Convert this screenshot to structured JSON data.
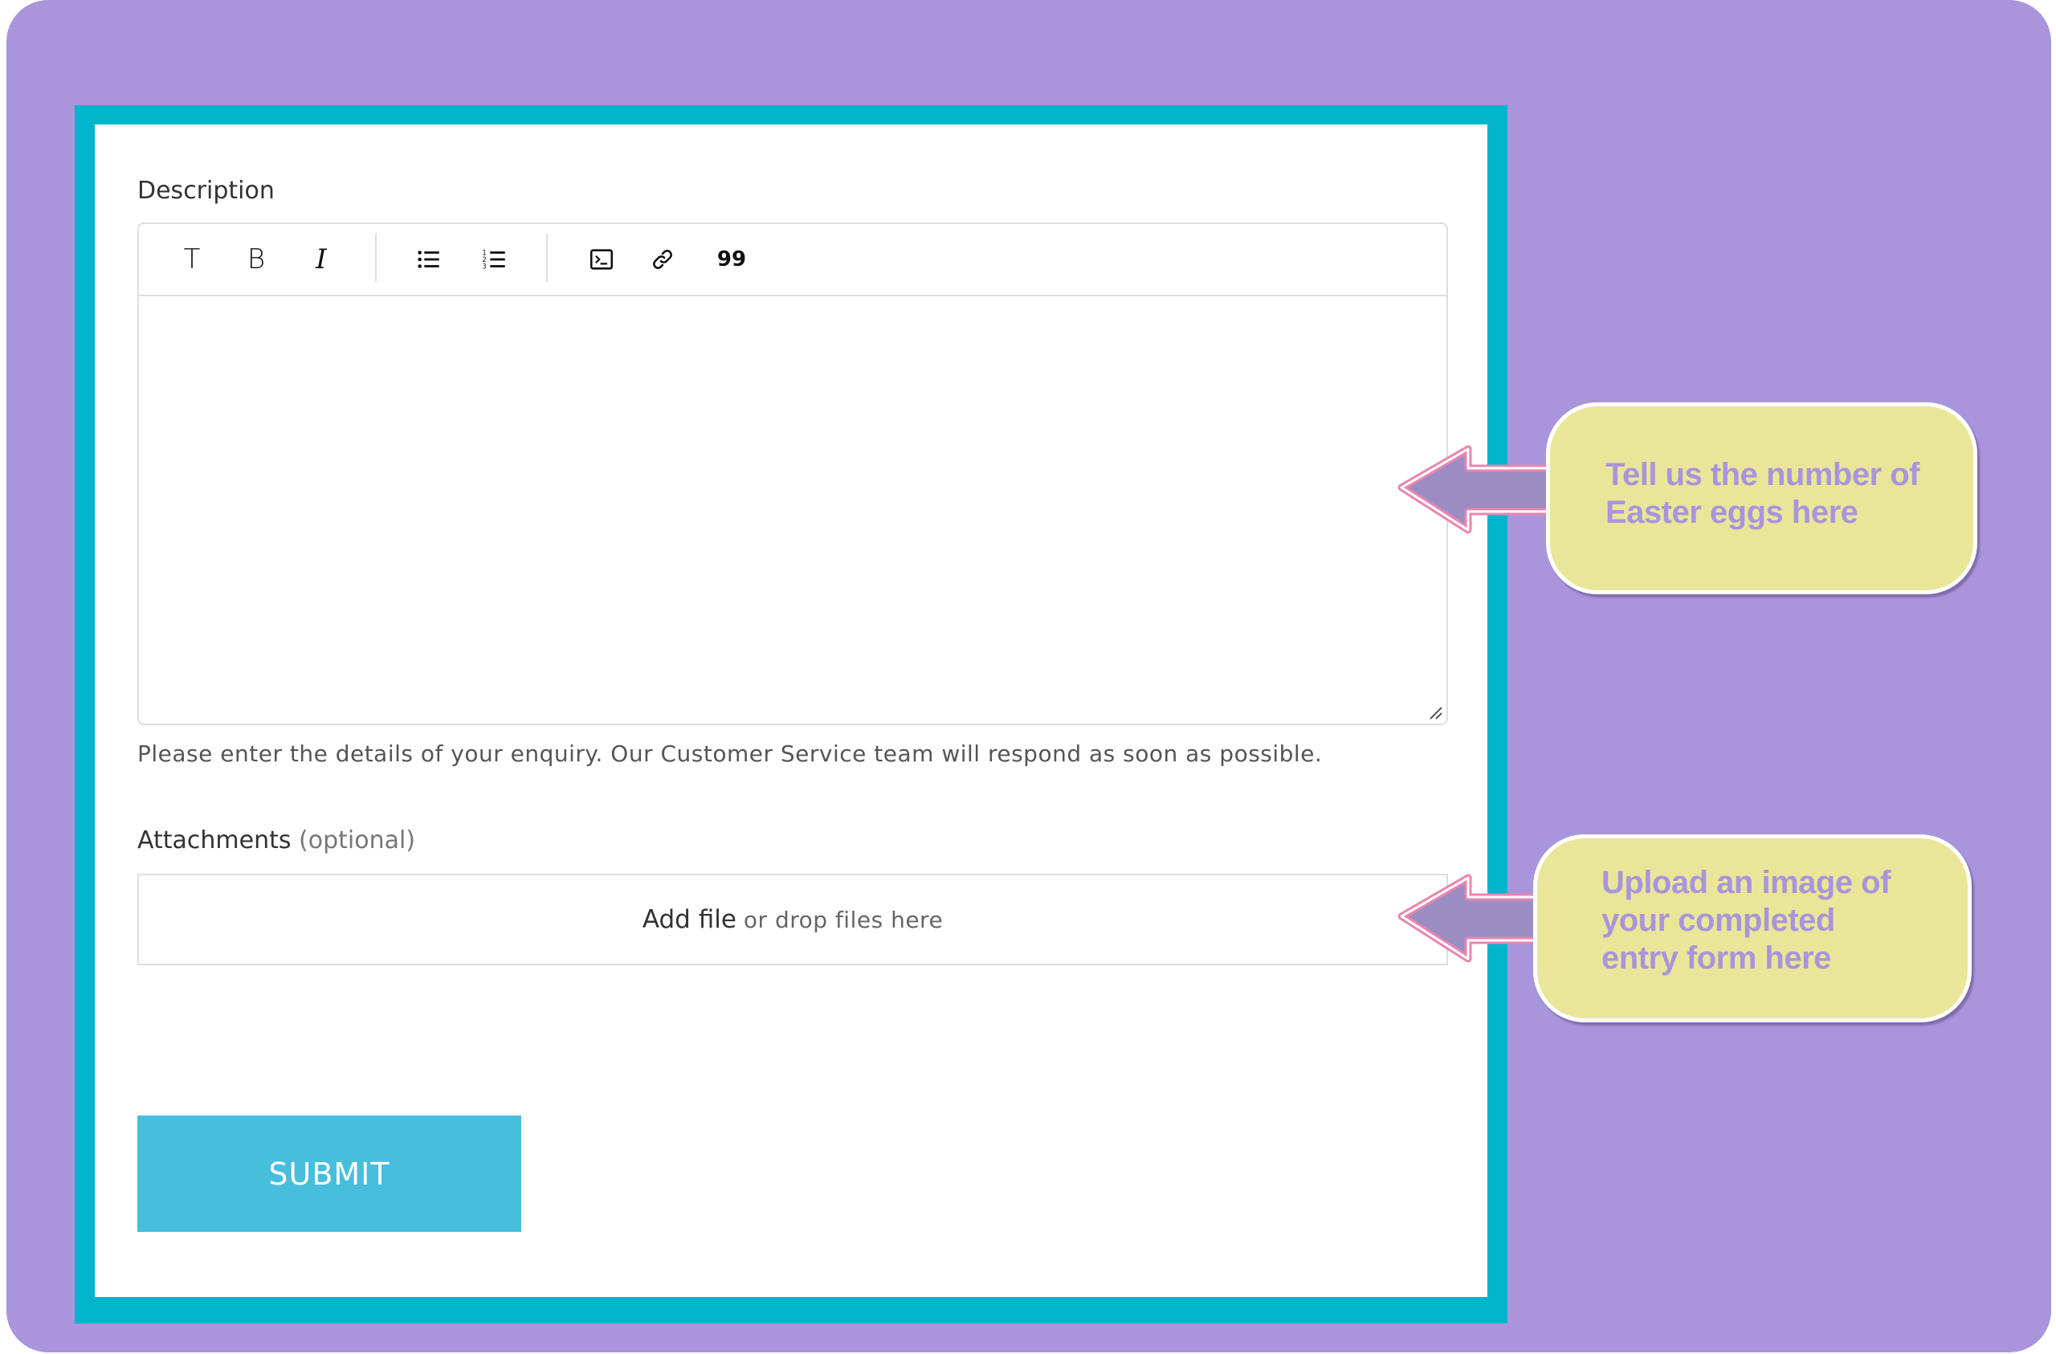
{
  "colors": {
    "background": "#a995db",
    "frame": "#00b5cb",
    "submit": "#47bedc",
    "callout_fill": "#e9e699",
    "callout_text": "#a995db",
    "arrow_fill": "#9b8dc4",
    "arrow_outline": "#e985b0"
  },
  "form": {
    "description_label": "Description",
    "toolbar": [
      {
        "name": "text-style",
        "icon": "text-t-icon",
        "label": "T"
      },
      {
        "name": "bold",
        "icon": "bold-icon",
        "label": "B"
      },
      {
        "name": "italic",
        "icon": "italic-icon",
        "label": "I"
      },
      {
        "name": "bulleted-list",
        "icon": "bulleted-list-icon"
      },
      {
        "name": "numbered-list",
        "icon": "numbered-list-icon"
      },
      {
        "name": "code-block",
        "icon": "terminal-icon"
      },
      {
        "name": "link",
        "icon": "link-icon"
      },
      {
        "name": "quote",
        "icon": "quote-icon",
        "label": "99"
      }
    ],
    "description_value": "",
    "helper_text": "Please enter the details of your enquiry. Our Customer Service team will respond as soon as possible.",
    "attachments_label": "Attachments",
    "attachments_optional": "(optional)",
    "dropzone_add": "Add file",
    "dropzone_rest": "or drop files here",
    "submit_label": "SUBMIT"
  },
  "callouts": [
    {
      "text_lines": [
        "Tell us the number of",
        "Easter eggs here"
      ]
    },
    {
      "text_lines": [
        "Upload an image of",
        "your completed",
        "entry form here"
      ]
    }
  ]
}
